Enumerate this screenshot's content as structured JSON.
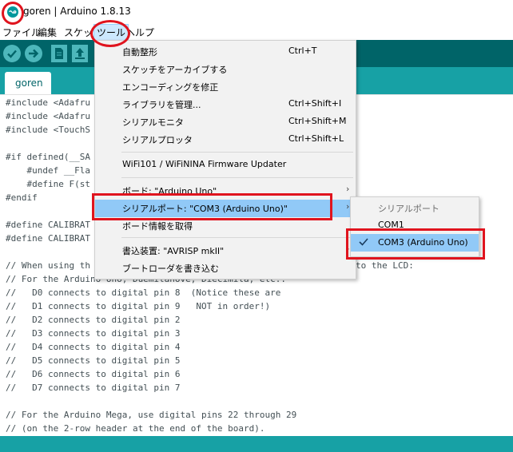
{
  "window": {
    "title": "goren | Arduino 1.8.13"
  },
  "menubar": {
    "items": [
      "ファイル",
      "編集",
      "スケッチ",
      "ツール",
      "ヘルプ"
    ],
    "active": "ツール"
  },
  "toolbar": {
    "buttons": [
      "verify-icon",
      "upload-icon",
      "new-icon",
      "open-icon",
      "save-icon"
    ],
    "accent": "#006468",
    "button_color": "#4db7bb"
  },
  "tabs": [
    {
      "label": "goren"
    }
  ],
  "editor": {
    "lines": [
      "#include <Adafru",
      "#include <Adafru",
      "#include <TouchS",
      "",
      "#if defined(__SA",
      "    #undef __Fla",
      "    #define F(st",
      "#endif",
      "",
      "#define CALIBRAT",
      "#define CALIBRAT",
      "",
      "// When using th",
      "// For the Arduino Uno, Duemilanove, Diecimila, etc.:",
      "//   D0 connects to digital pin 8  (Notice these are",
      "//   D1 connects to digital pin 9   NOT in order!)",
      "//   D2 connects to digital pin 2",
      "//   D3 connects to digital pin 3",
      "//   D4 connects to digital pin 4",
      "//   D5 connects to digital pin 5",
      "//   D6 connects to digital pin 6",
      "//   D7 connects to digital pin 7",
      "",
      "// For the Arduino Mega, use digital pins 22 through 29",
      "// (on the 2-row header at the end of the board)."
    ],
    "overflow_text": "to the LCD:"
  },
  "tools_menu": {
    "items": [
      {
        "label": "自動整形",
        "shortcut": "Ctrl+T"
      },
      {
        "label": "スケッチをアーカイブする",
        "shortcut": ""
      },
      {
        "label": "エンコーディングを修正",
        "shortcut": ""
      },
      {
        "label": "ライブラリを管理...",
        "shortcut": "Ctrl+Shift+I"
      },
      {
        "label": "シリアルモニタ",
        "shortcut": "Ctrl+Shift+M"
      },
      {
        "label": "シリアルプロッタ",
        "shortcut": "Ctrl+Shift+L"
      },
      {
        "label": "WiFi101 / WiFiNINA Firmware Updater",
        "shortcut": ""
      },
      {
        "label": "ボード: \"Arduino Uno\"",
        "shortcut": ""
      },
      {
        "label": "シリアルポート: \"COM3 (Arduino Uno)\"",
        "shortcut": ""
      },
      {
        "label": "ボード情報を取得",
        "shortcut": ""
      },
      {
        "label": "書込装置: \"AVRISP mkII\"",
        "shortcut": ""
      },
      {
        "label": "ブートローダを書き込む",
        "shortcut": ""
      }
    ],
    "highlighted": "シリアルポート: \"COM3 (Arduino Uno)\"",
    "submenu_arrow": "›"
  },
  "port_submenu": {
    "header": "シリアルポート",
    "options": [
      "COM1",
      "COM3 (Arduino Uno)"
    ],
    "selected": "COM3 (Arduino Uno)"
  },
  "colors": {
    "highlight": "#91c9f7",
    "annotation_red": "#e0141e",
    "tab_strip": "#17a1a5"
  }
}
